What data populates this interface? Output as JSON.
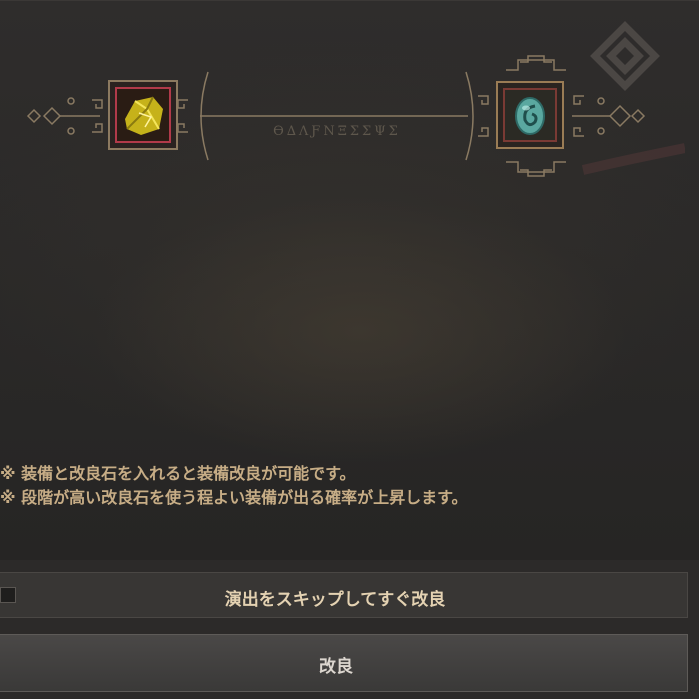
{
  "upgrade": {
    "equipment_slot_icon": "gold-ore-icon",
    "stone_slot_icon": "teal-egg-stone-icon",
    "rune_text": "ϴ∆ΛƑΝΞΣΣΨΣ",
    "notes": [
      "※ 装備と改良石を入れると装備改良が可能です。",
      "※ 段階が高い改良石を使う程よい装備が出る確率が上昇します。"
    ]
  },
  "controls": {
    "skip_label": "演出をスキップしてすぐ改良",
    "skip_checked": false,
    "upgrade_label": "改良"
  },
  "colors": {
    "accent_gold": "#c7ad86",
    "frame_gold": "#9a7c55",
    "slot_red": "#b13a4a"
  }
}
